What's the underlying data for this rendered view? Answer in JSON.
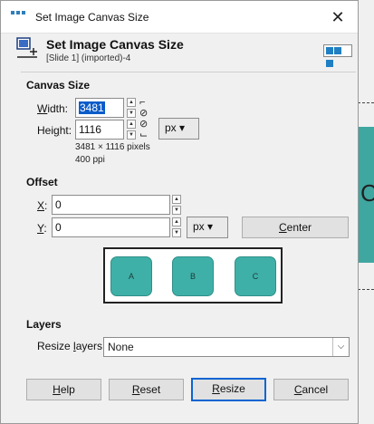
{
  "window": {
    "title": "Set Image Canvas Size"
  },
  "header": {
    "title": "Set Image Canvas Size",
    "subtitle": "[Slide 1] (imported)-4"
  },
  "canvas_size": {
    "heading": "Canvas Size",
    "width_label_pre": "",
    "width_label_u": "W",
    "width_label_post": "idth:",
    "width_value": "3481",
    "height_label_pre": "Hei",
    "height_label_u": "g",
    "height_label_post": "ht:",
    "height_value": "1116",
    "unit": "px",
    "dims_text": "3481 × 1116 pixels",
    "ppi_text": "400 ppi"
  },
  "offset": {
    "heading": "Offset",
    "x_label_u": "X",
    "x_label_post": ":",
    "x_value": "0",
    "y_label_u": "Y",
    "y_label_post": ":",
    "y_value": "0",
    "unit": "px",
    "center_pre": "",
    "center_u": "C",
    "center_post": "enter"
  },
  "preview": {
    "boxes": [
      "A",
      "B",
      "C"
    ]
  },
  "layers": {
    "heading": "Layers",
    "resize_label_pre": "Resize ",
    "resize_label_u": "l",
    "resize_label_post": "ayers:",
    "resize_value": "None"
  },
  "buttons": {
    "help_u": "H",
    "help_post": "elp",
    "reset_u": "R",
    "reset_post": "eset",
    "resize_u": "R",
    "resize_post": "esize",
    "cancel_u": "C",
    "cancel_post": "ancel"
  },
  "background": {
    "letter": "C"
  },
  "colors": {
    "accent": "#0a64d2",
    "box_fill": "#3fb0a8",
    "bg_teal": "#3fa6a0"
  }
}
